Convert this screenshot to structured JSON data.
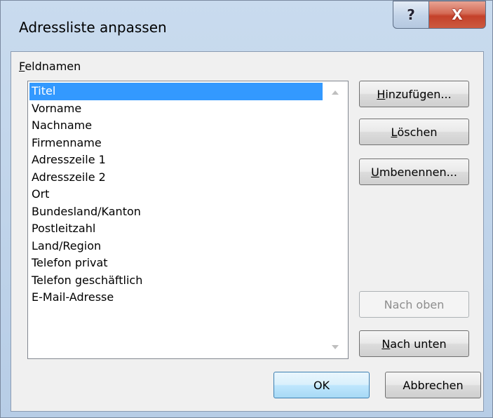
{
  "window": {
    "title": "Adressliste anpassen",
    "help_glyph": "?",
    "close_glyph": "X"
  },
  "fields": {
    "label_mnemonic": "F",
    "label_rest": "eldnamen",
    "items": [
      "Titel",
      "Vorname",
      "Nachname",
      "Firmenname",
      "Adresszeile 1",
      "Adresszeile 2",
      "Ort",
      "Bundesland/Kanton",
      "Postleitzahl",
      "Land/Region",
      "Telefon privat",
      "Telefon geschäftlich",
      "E-Mail-Adresse"
    ],
    "selected_index": 0
  },
  "buttons": {
    "add": {
      "mnemonic": "H",
      "rest": "inzufügen..."
    },
    "delete": {
      "pre": "",
      "mnemonic": "L",
      "rest": "öschen"
    },
    "rename": {
      "mnemonic": "U",
      "rest": "mbenennen..."
    },
    "move_up": {
      "label": "Nach oben",
      "enabled": false
    },
    "move_down": {
      "mnemonic": "N",
      "rest": "ach unten"
    },
    "ok": "OK",
    "cancel": "Abbrechen"
  },
  "colors": {
    "selection": "#3399ff",
    "close_button": "#c4412a",
    "dialog_background": "#f0f0f0"
  }
}
